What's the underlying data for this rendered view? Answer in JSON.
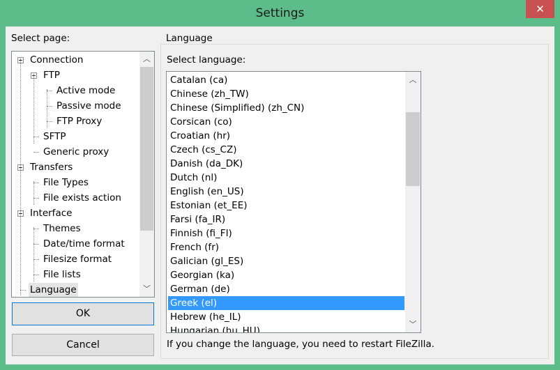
{
  "window": {
    "title": "Settings",
    "close_icon": "close-icon"
  },
  "left": {
    "select_page_label": "Select page:",
    "tree": [
      {
        "label": "Connection",
        "level": 0,
        "expanded": true
      },
      {
        "label": "FTP",
        "level": 1,
        "expanded": true
      },
      {
        "label": "Active mode",
        "level": 2
      },
      {
        "label": "Passive mode",
        "level": 2
      },
      {
        "label": "FTP Proxy",
        "level": 2
      },
      {
        "label": "SFTP",
        "level": 1
      },
      {
        "label": "Generic proxy",
        "level": 1
      },
      {
        "label": "Transfers",
        "level": 0,
        "expanded": true
      },
      {
        "label": "File Types",
        "level": 1
      },
      {
        "label": "File exists action",
        "level": 1
      },
      {
        "label": "Interface",
        "level": 0,
        "expanded": true
      },
      {
        "label": "Themes",
        "level": 1
      },
      {
        "label": "Date/time format",
        "level": 1
      },
      {
        "label": "Filesize format",
        "level": 1
      },
      {
        "label": "File lists",
        "level": 1
      },
      {
        "label": "Language",
        "level": 0,
        "selected": true
      }
    ],
    "ok_label": "OK",
    "cancel_label": "Cancel"
  },
  "right": {
    "group_label": "Language",
    "select_language_label": "Select language:",
    "languages": [
      "Catalan (ca)",
      "Chinese (zh_TW)",
      "Chinese (Simplified) (zh_CN)",
      "Corsican (co)",
      "Croatian (hr)",
      "Czech (cs_CZ)",
      "Danish (da_DK)",
      "Dutch (nl)",
      "English (en_US)",
      "Estonian (et_EE)",
      "Farsi (fa_IR)",
      "Finnish (fi_FI)",
      "French (fr)",
      "Galician (gl_ES)",
      "Georgian (ka)",
      "German (de)",
      "Greek (el)",
      "Hebrew (he_IL)",
      "Hungarian (hu_HU)"
    ],
    "selected_language": "Greek (el)",
    "note": "If you change the language, you need to restart FileZilla."
  },
  "colors": {
    "titlebar": "#5cbd8b",
    "close": "#c75050",
    "selection": "#3399ff"
  }
}
